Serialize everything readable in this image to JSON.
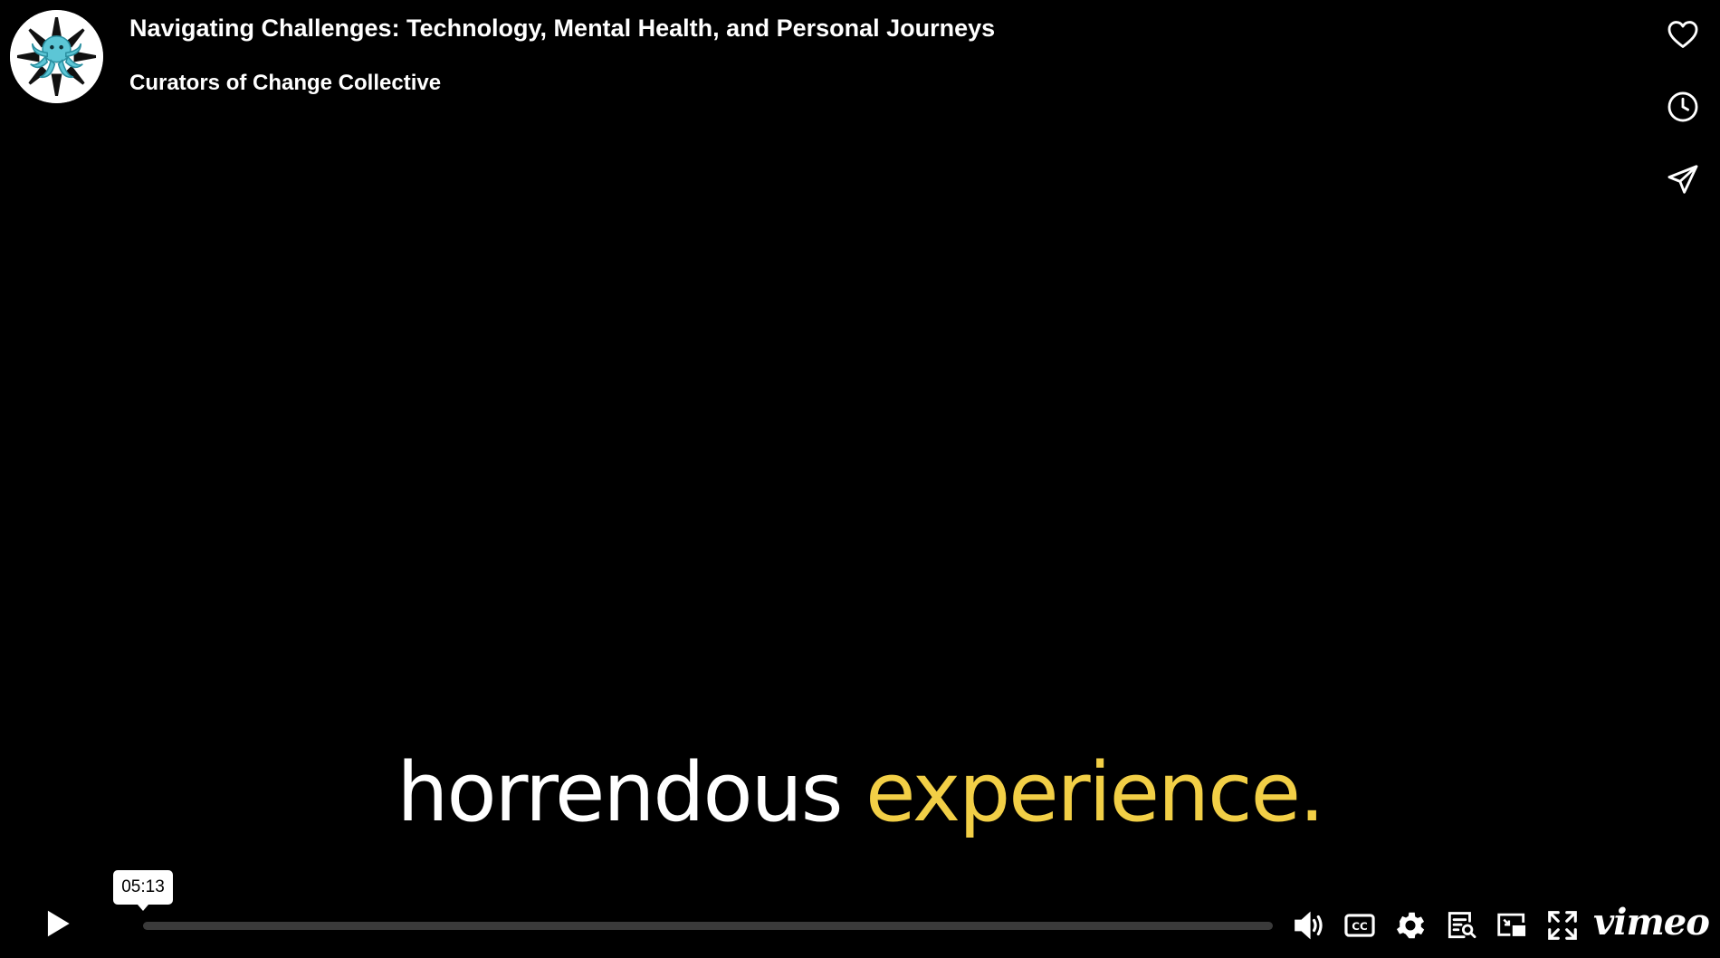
{
  "header": {
    "title": "Navigating Challenges: Technology, Mental Health, and Personal Journeys",
    "channel": "Curators of Change Collective",
    "avatar_icon": "octopus-compass-logo"
  },
  "side_actions": [
    {
      "name": "like",
      "icon": "heart-icon"
    },
    {
      "name": "watch-later",
      "icon": "clock-icon"
    },
    {
      "name": "share",
      "icon": "paper-plane-icon"
    }
  ],
  "caption": {
    "word1": "horrendous",
    "word2": "experience.",
    "word1_color": "#ffffff",
    "word2_color": "#f2cf46"
  },
  "player": {
    "hover_time": "05:13",
    "progress_fraction": 0.0,
    "controls": [
      "play-icon",
      "volume-icon",
      "captions-icon",
      "settings-icon",
      "transcript-icon",
      "picture-in-picture-icon",
      "fullscreen-icon"
    ],
    "brand": "vimeo"
  }
}
